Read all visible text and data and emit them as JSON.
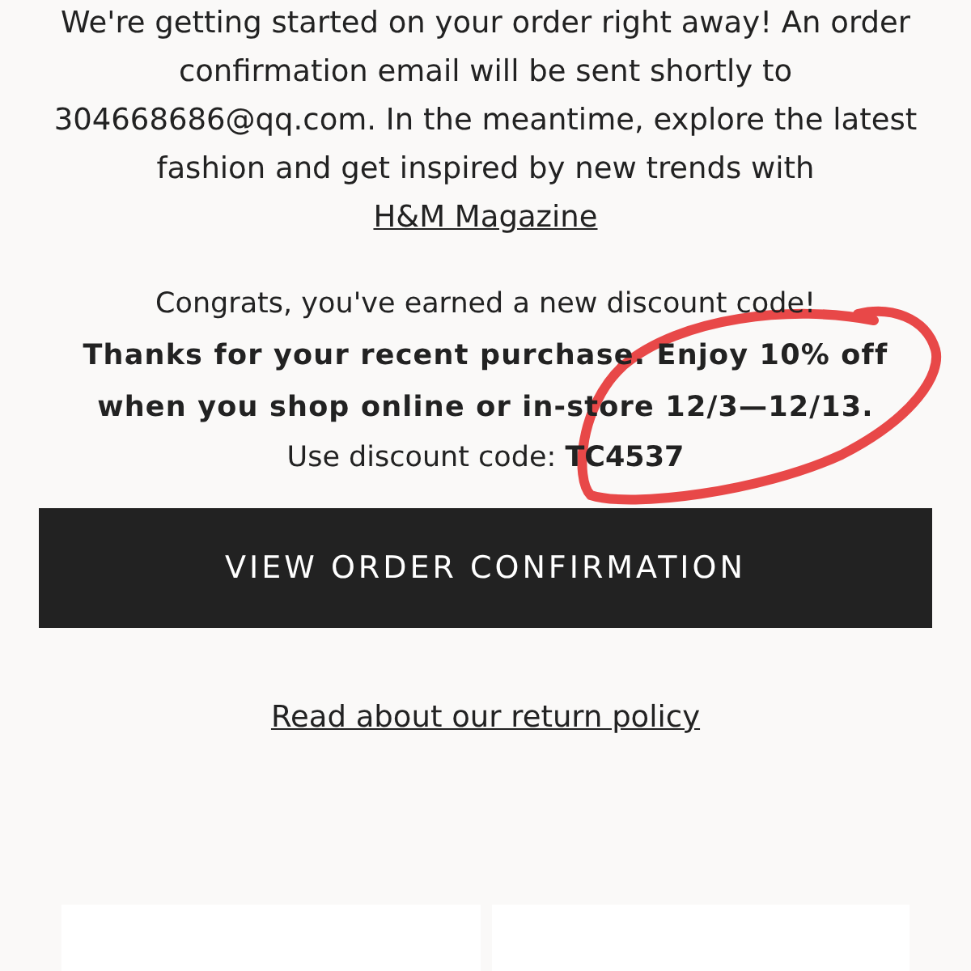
{
  "intro": {
    "text": "We're getting started on your order right away! An order confirmation email will be sent shortly to 304668686@qq.com. In the meantime, explore the latest fashion and get inspired by new trends with",
    "link": "H&M Magazine"
  },
  "discount": {
    "headline": "Congrats, you've earned a new discount code!",
    "details": "Thanks for your recent purchase. Enjoy 10% off when you shop online or in-store 12/3—12/13.",
    "code_line": "Use discount code: **TC4537**"
  },
  "button": "VIEW ORDER CONFIRMATION",
  "return_link": "Read about our return policy"
}
